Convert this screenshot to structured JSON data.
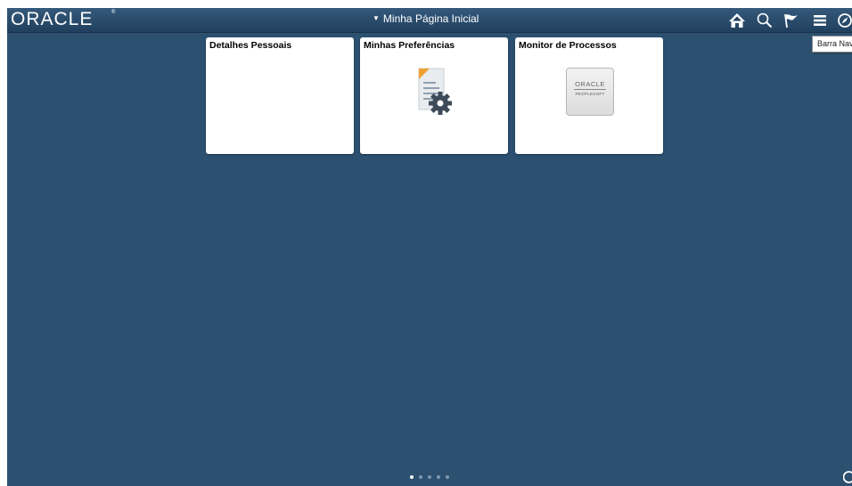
{
  "header": {
    "logo_text": "ORACLE",
    "logo_mark": "®",
    "page_title": "Minha Página Inicial",
    "title_caret_icon": "caret-down-icon",
    "actions": [
      {
        "name": "home-icon"
      },
      {
        "name": "search-icon"
      },
      {
        "name": "flag-icon"
      },
      {
        "name": "menu-icon"
      },
      {
        "name": "navbar-icon"
      }
    ],
    "tooltip": "Barra Nav"
  },
  "tiles": [
    {
      "title": "Detalhes Pessoais",
      "icon": ""
    },
    {
      "title": "Minhas Preferências",
      "icon": "document-gear-icon"
    },
    {
      "title": "Monitor de Processos",
      "icon": "oracle-peoplesoft-logo",
      "logo_line1": "ORACLE",
      "logo_line2": "PEOPLESOFT"
    }
  ],
  "pager": {
    "count": 5,
    "active_index": 0
  },
  "colors": {
    "background": "#2c5070",
    "header": "#21405e",
    "tile": "#ffffff",
    "gear": "#3d4a57",
    "accent_orange": "#f0a030"
  }
}
